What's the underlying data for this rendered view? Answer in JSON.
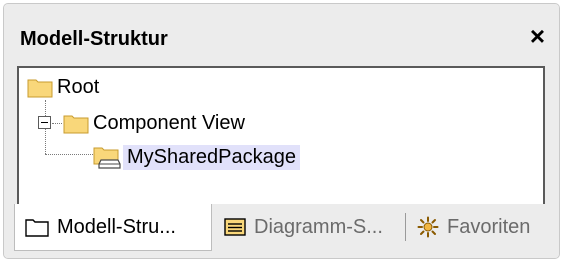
{
  "panel": {
    "title": "Modell-Struktur",
    "close_label": "×"
  },
  "tree": {
    "root_label": "Root",
    "component_view_label": "Component View",
    "shared_package_label": "MySharedPackage"
  },
  "tabs": [
    {
      "label": "Modell-Stru...",
      "icon": "folder-icon",
      "active": true
    },
    {
      "label": "Diagramm-S...",
      "icon": "diagram-list-icon",
      "active": false
    },
    {
      "label": "Favoriten",
      "icon": "favorites-star-icon",
      "active": false
    }
  ],
  "colors": {
    "folder_fill": "#f9d77a",
    "folder_edge": "#c89b2e",
    "selection": "#e1e1fa",
    "inactive_tab_text": "#6b6b6b"
  }
}
